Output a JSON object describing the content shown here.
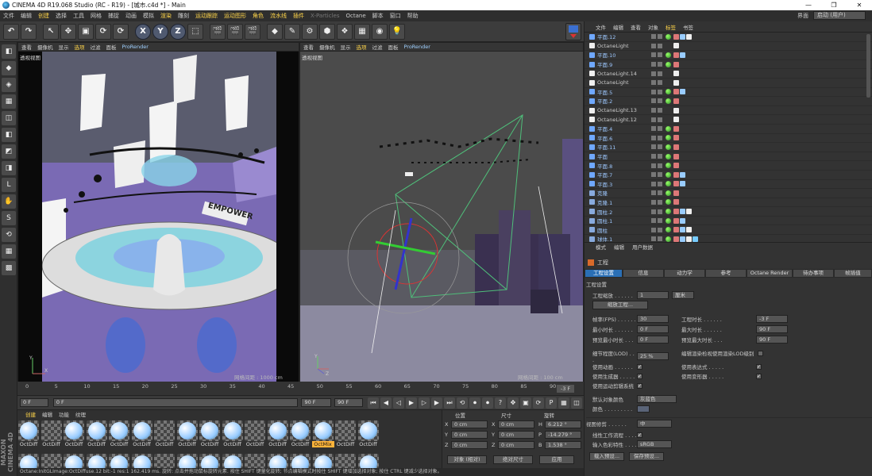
{
  "window": {
    "title": "CINEMA 4D R19.068 Studio (RC - R19) - [城市.c4d *] - Main",
    "controls": [
      "—",
      "❐",
      "✕"
    ]
  },
  "menu": {
    "items": [
      "文件",
      "编辑",
      "创建",
      "选择",
      "工具",
      "网格",
      "捕捉",
      "动画",
      "模拟",
      "渲染",
      "雕刻",
      "运动跟踪",
      "运动图形",
      "角色",
      "流水线",
      "插件",
      "X-Particles",
      "Octane",
      "脚本",
      "窗口",
      "帮助"
    ],
    "highlight": [
      2,
      9,
      11,
      12,
      13,
      14,
      15
    ],
    "dim": [
      16
    ]
  },
  "layout": {
    "label": "界面",
    "value": "启动 (用户)"
  },
  "toolbar": {
    "buttons": [
      "↶",
      "↷",
      "↖",
      "✥",
      "▣",
      "⟳",
      "⟳",
      "X",
      "Y",
      "Z",
      "⬚",
      "🎬",
      "🎬",
      "🎬",
      "◆",
      "✎",
      "⚙",
      "⬢",
      "❖",
      "▦",
      "◉",
      "💡"
    ]
  },
  "lefttools": {
    "buttons": [
      "◧",
      "◆",
      "◈",
      "▦",
      "◫",
      "◧",
      "◩",
      "◨",
      "L",
      "✋",
      "S",
      "⟲",
      "▦",
      "▩"
    ]
  },
  "viewport_left": {
    "menu": [
      "查看",
      "摄像机",
      "显示",
      "选项",
      "过滤",
      "面板",
      "ProRender"
    ],
    "selected": 3,
    "label": "透视视图",
    "info": "网格间距 : 1000 cm",
    "watermark": "EMPOWER"
  },
  "viewport_right": {
    "menu": [
      "查看",
      "摄像机",
      "显示",
      "选项",
      "过滤",
      "面板",
      "ProRender"
    ],
    "selected": 3,
    "label": "透视视图",
    "info": "网格间距 : 100 cm"
  },
  "timeline": {
    "ticks": [
      "0",
      "5",
      "10",
      "15",
      "20",
      "25",
      "30",
      "35",
      "40",
      "45",
      "50",
      "55",
      "60",
      "65",
      "70",
      "75",
      "80",
      "85",
      "90"
    ],
    "frame": "-3 F"
  },
  "transport": {
    "start": "0 F",
    "current": "0 F",
    "end": "90 F",
    "end2": "90 F",
    "buttons": [
      "⏮",
      "◀",
      "◁",
      "▶",
      "▷",
      "▶",
      "⏭",
      "⟲",
      "⏺",
      "⏺",
      "?",
      "✥",
      "▣",
      "⟳",
      "P",
      "▦",
      "◫"
    ]
  },
  "material": {
    "tabs": [
      "创建",
      "编辑",
      "功能",
      "纹理"
    ],
    "selected": 0,
    "row1": [
      "OctDiff",
      "OctDiff",
      "OctDiff",
      "OctDiff",
      "OctDiff",
      "OctDiff",
      "OctDiff",
      "OctDiff",
      "OctDiff",
      "OctDiff",
      "OctDiff",
      "OctDiff",
      "OctDiff",
      "OctMix",
      "OctDiff",
      "OctDiff"
    ],
    "active": 13,
    "plain": [
      1,
      6,
      10,
      14
    ]
  },
  "coords": {
    "headers": [
      "位置",
      "尺寸",
      "旋转"
    ],
    "rows": [
      {
        "a": "X",
        "v1": "0 cm",
        "b": "X",
        "v2": "0 cm",
        "c": "H",
        "v3": "6.212 °"
      },
      {
        "a": "Y",
        "v1": "0 cm",
        "b": "Y",
        "v2": "0 cm",
        "c": "P",
        "v3": "-14.279 °"
      },
      {
        "a": "Z",
        "v1": "0 cm",
        "b": "Z",
        "v2": "0 cm",
        "c": "B",
        "v3": "1.538 °"
      }
    ],
    "mode": "对象 (相对)",
    "size": "绝对尺寸",
    "apply": "应用"
  },
  "objects": {
    "tabs": [
      "文件",
      "编辑",
      "查看",
      "对象",
      "标签",
      "书签"
    ],
    "selected": 4,
    "rows": [
      {
        "name": "平面.12",
        "type": "plane",
        "tags": 3
      },
      {
        "name": "OctaneLight",
        "type": "light",
        "tags": 1
      },
      {
        "name": "平面.10",
        "type": "plane",
        "tags": 2
      },
      {
        "name": "平面.9",
        "type": "plane",
        "tags": 1
      },
      {
        "name": "OctaneLight.14",
        "type": "light",
        "tags": 1
      },
      {
        "name": "OctaneLight",
        "type": "light",
        "tags": 1
      },
      {
        "name": "平面.5",
        "type": "plane",
        "tags": 2
      },
      {
        "name": "平面.2",
        "type": "plane",
        "tags": 1
      },
      {
        "name": "OctaneLight.13",
        "type": "light",
        "tags": 1
      },
      {
        "name": "OctaneLight.12",
        "type": "light",
        "tags": 1
      },
      {
        "name": "平面.4",
        "type": "plane",
        "tags": 1
      },
      {
        "name": "平面.6",
        "type": "plane",
        "tags": 1
      },
      {
        "name": "平面.11",
        "type": "plane",
        "tags": 1
      },
      {
        "name": "平面",
        "type": "plane",
        "tags": 1
      },
      {
        "name": "平面.8",
        "type": "plane",
        "tags": 1
      },
      {
        "name": "平面.7",
        "type": "plane",
        "tags": 2
      },
      {
        "name": "平面.3",
        "type": "plane",
        "tags": 2
      },
      {
        "name": "克隆",
        "type": "clone",
        "tags": 1
      },
      {
        "name": "克隆.1",
        "type": "clone",
        "tags": 1
      },
      {
        "name": "圆柱.2",
        "type": "cyl",
        "tags": 3
      },
      {
        "name": "圆柱.1",
        "type": "cyl",
        "tags": 2
      },
      {
        "name": "圆柱",
        "type": "cyl",
        "tags": 3
      },
      {
        "name": "球体.1",
        "type": "cyl",
        "tags": 4
      }
    ]
  },
  "attributes": {
    "tabs": [
      "模式",
      "编辑",
      "用户数据"
    ],
    "object": "工程",
    "ptabs": [
      "工程设置",
      "信息",
      "动力学",
      "参考",
      "Octane Render",
      "待办事项",
      "帧插值"
    ],
    "psel": 0,
    "section": "工程设置",
    "scale_label": "工程缩放 . . . . . .",
    "scale_value": "1",
    "scale_unit": "厘米",
    "scale_btn": "缩放工程...",
    "fps_label": "帧率(FPS) . . . . . .",
    "fps": "30",
    "proj_time_label": "工程时长 . . . . . .",
    "proj_time": "-3 F",
    "min_time_label": "最小时长 . . . . . .",
    "min_time": "0 F",
    "max_time_label": "最大时长 . . . . . .",
    "max_time": "90 F",
    "prev_min_label": "预览最小时长 . . .",
    "prev_min": "0 F",
    "prev_max_label": "预览最大时长 . . .",
    "prev_max": "90 F",
    "lod_label": "细节程度(LOD) . . .",
    "lod": "25 %",
    "lod_render_label": "编辑渲染检视使用渲染LOD级别",
    "use_anim": "使用动画 . . . . . .",
    "use_expr": "使用表达式 . . . . .",
    "use_gen": "使用生成器 . . . . .",
    "use_deform": "使用变形器 . . . . .",
    "use_mograph": "使用运动剪辑系统",
    "def_color_label": "默认对象颜色",
    "def_color": "灰蓝色",
    "color_label": "颜色 . . . . . . . . .",
    "view_clip_label": "视图修剪 . . . . . .",
    "view_clip": "中",
    "linear_label": "线性工作流程 . . . .",
    "input_color_label": "输入色彩特性 . . . .",
    "input_color": "sRGB",
    "load_preset": "载入预设...",
    "save_preset": "保存预设..."
  },
  "status": "Octane:InitGLImage:OctDiffuse.12  bit:-1 res:1 162.419 ms.    旋转: 点击并拖动鼠标旋转元素. 按住 SHIFT 键量化旋转; 节点编辑模式时按住 SHIFT 键增加选择对象; 按住 CTRL 键减少选择对象。",
  "brand": "MAXON CINEMA 4D",
  "colors": {
    "accent": "#ffd54a",
    "selected_tab": "#2a6fb5",
    "scene_purple": "#8a78c8"
  }
}
